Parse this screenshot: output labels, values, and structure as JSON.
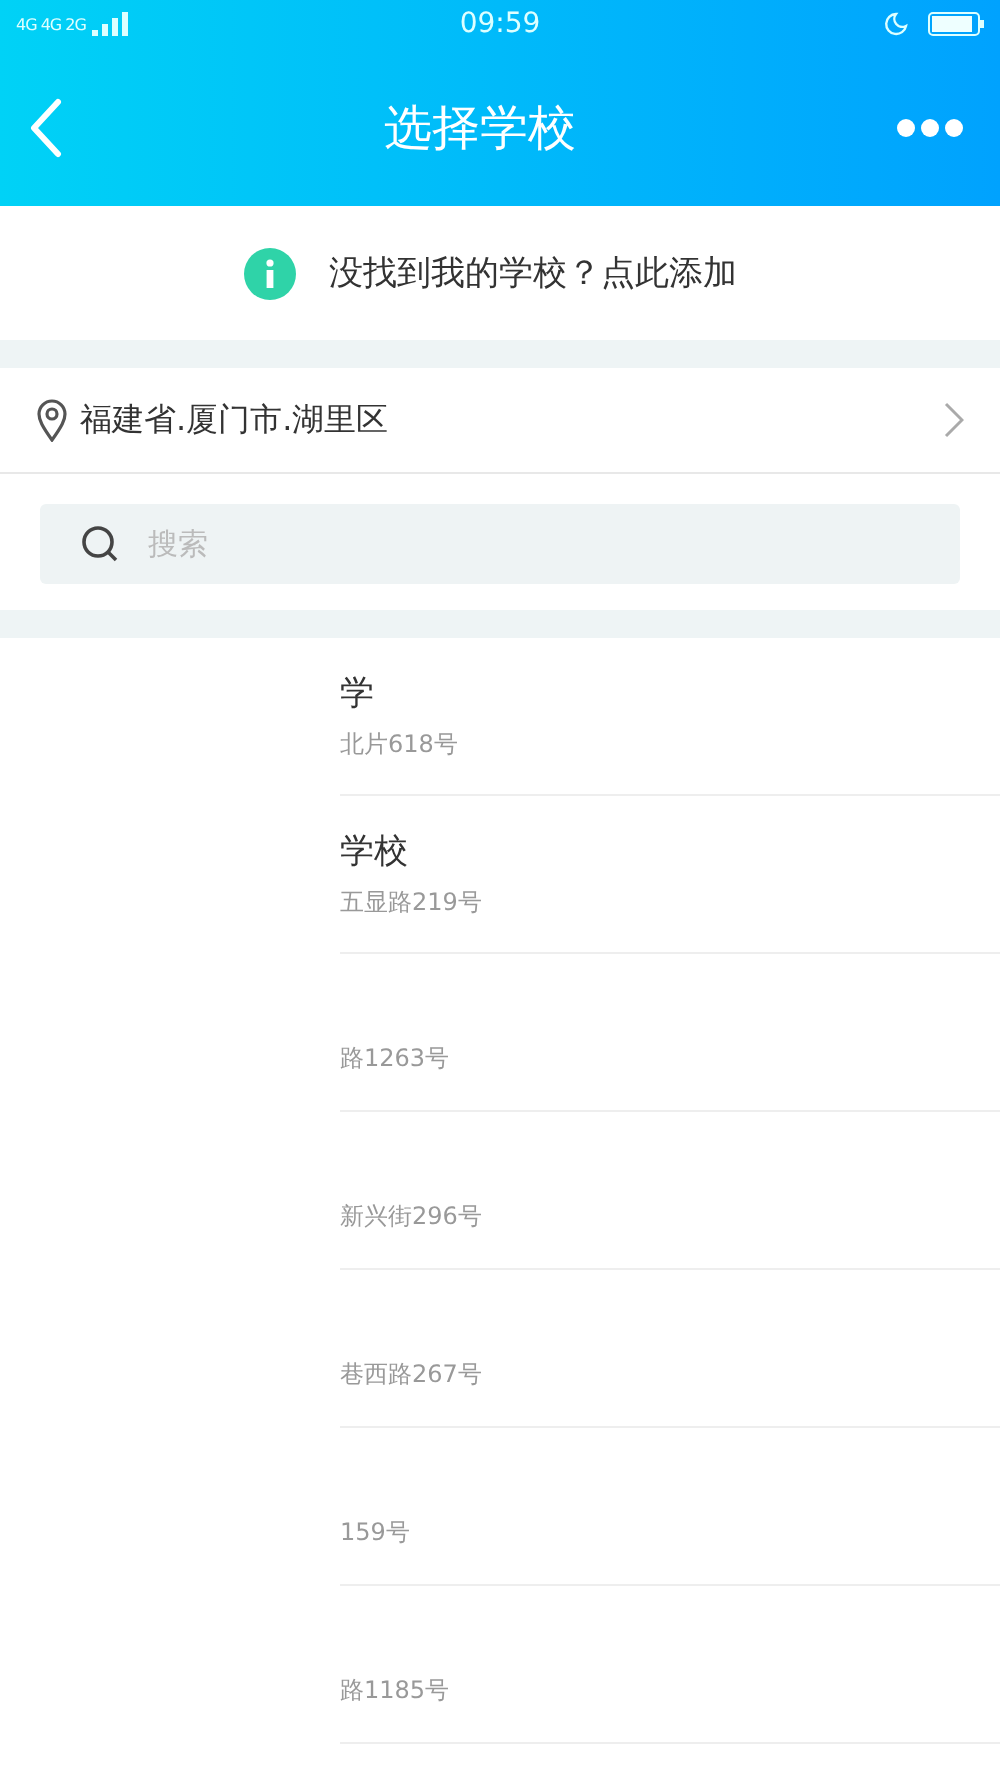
{
  "status_bar": {
    "network": "4G 4G 2G",
    "time": "09:59"
  },
  "header": {
    "title": "选择学校"
  },
  "add_notice": {
    "text": "没找到我的学校？点此添加"
  },
  "location": {
    "text": "福建省.厦门市.湖里区"
  },
  "search": {
    "placeholder": "搜索"
  },
  "schools": [
    {
      "name": "学",
      "address": "北片618号"
    },
    {
      "name": "学校",
      "address": "五显路219号"
    },
    {
      "address": "路1263号"
    },
    {
      "address": "新兴街296号"
    },
    {
      "address": "巷西路267号"
    },
    {
      "address": "159号"
    },
    {
      "address": "路1185号"
    }
  ]
}
